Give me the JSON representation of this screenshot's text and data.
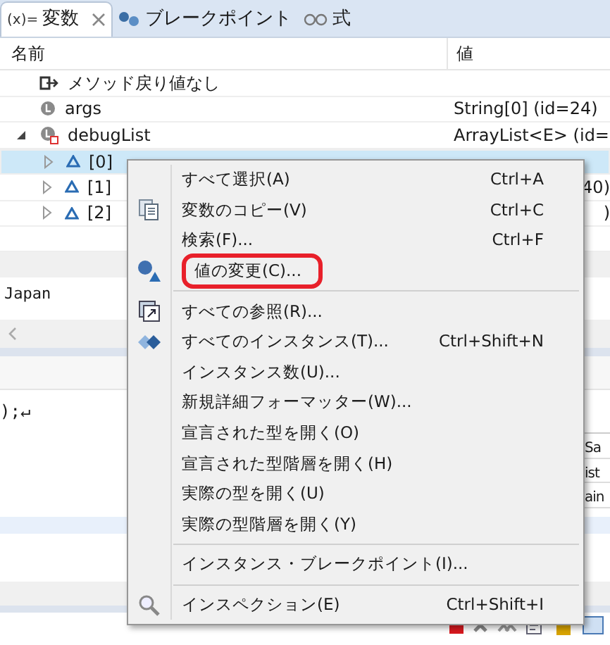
{
  "tabs": [
    {
      "icon_text": "(x)=",
      "label": "変数",
      "kind": "variables",
      "selected": true,
      "closable": true
    },
    {
      "label": "ブレークポイント",
      "kind": "breakpoints",
      "selected": false,
      "closable": false
    },
    {
      "label": "式",
      "kind": "expressions",
      "selected": false,
      "closable": false
    }
  ],
  "table": {
    "columns": [
      "名前",
      "値"
    ],
    "rows": [
      {
        "name": "メソッド戻り値なし",
        "kind": "return",
        "selected": false
      },
      {
        "name": "args",
        "kind": "local",
        "value": "String[0]  (id=24)",
        "selected": false
      },
      {
        "name": "debugList",
        "kind": "list",
        "value": "ArrayList<E>  (id=",
        "selected": false,
        "expanded": true,
        "children": [
          {
            "name": "[0]",
            "kind": "element",
            "selected": true,
            "expanded": false
          },
          {
            "name": "[1]",
            "kind": "element",
            "value": "40)",
            "selected": false,
            "expanded": false
          },
          {
            "name": "[2]",
            "kind": "element",
            "value": ")",
            "selected": false,
            "expanded": false
          }
        ]
      }
    ]
  },
  "detail": {
    "text": "Japan"
  },
  "editor": {
    "lines": [
      ");↵"
    ],
    "right_fragments": [
      "Sa",
      "ist",
      "ain"
    ]
  },
  "context_menu": {
    "items": [
      {
        "kind": "item",
        "label": "すべて選択(A)",
        "shortcut": "Ctrl+A"
      },
      {
        "kind": "copy",
        "label": "変数のコピー(V)",
        "shortcut": "Ctrl+C"
      },
      {
        "kind": "item",
        "label": "検索(F)...",
        "shortcut": "Ctrl+F"
      },
      {
        "kind": "change",
        "label": "値の変更(C)...",
        "circled": true
      },
      {
        "kind": "separator"
      },
      {
        "kind": "references",
        "label": "すべての参照(R)..."
      },
      {
        "kind": "instances",
        "label": "すべてのインスタンス(T)...",
        "shortcut": "Ctrl+Shift+N"
      },
      {
        "kind": "item",
        "label": "インスタンス数(U)..."
      },
      {
        "kind": "item",
        "label": "新規詳細フォーマッター(W)..."
      },
      {
        "kind": "item",
        "label": "宣言された型を開く(O)"
      },
      {
        "kind": "item",
        "label": "宣言された型階層を開く(H)"
      },
      {
        "kind": "item",
        "label": "実際の型を開く(U)"
      },
      {
        "kind": "item",
        "label": "実際の型階層を開く(Y)"
      },
      {
        "kind": "separator"
      },
      {
        "kind": "item",
        "label": "インスタンス・ブレークポイント(I)..."
      },
      {
        "kind": "separator"
      },
      {
        "kind": "inspect",
        "label": "インスペクション(E)",
        "shortcut": "Ctrl+Shift+I"
      }
    ]
  }
}
